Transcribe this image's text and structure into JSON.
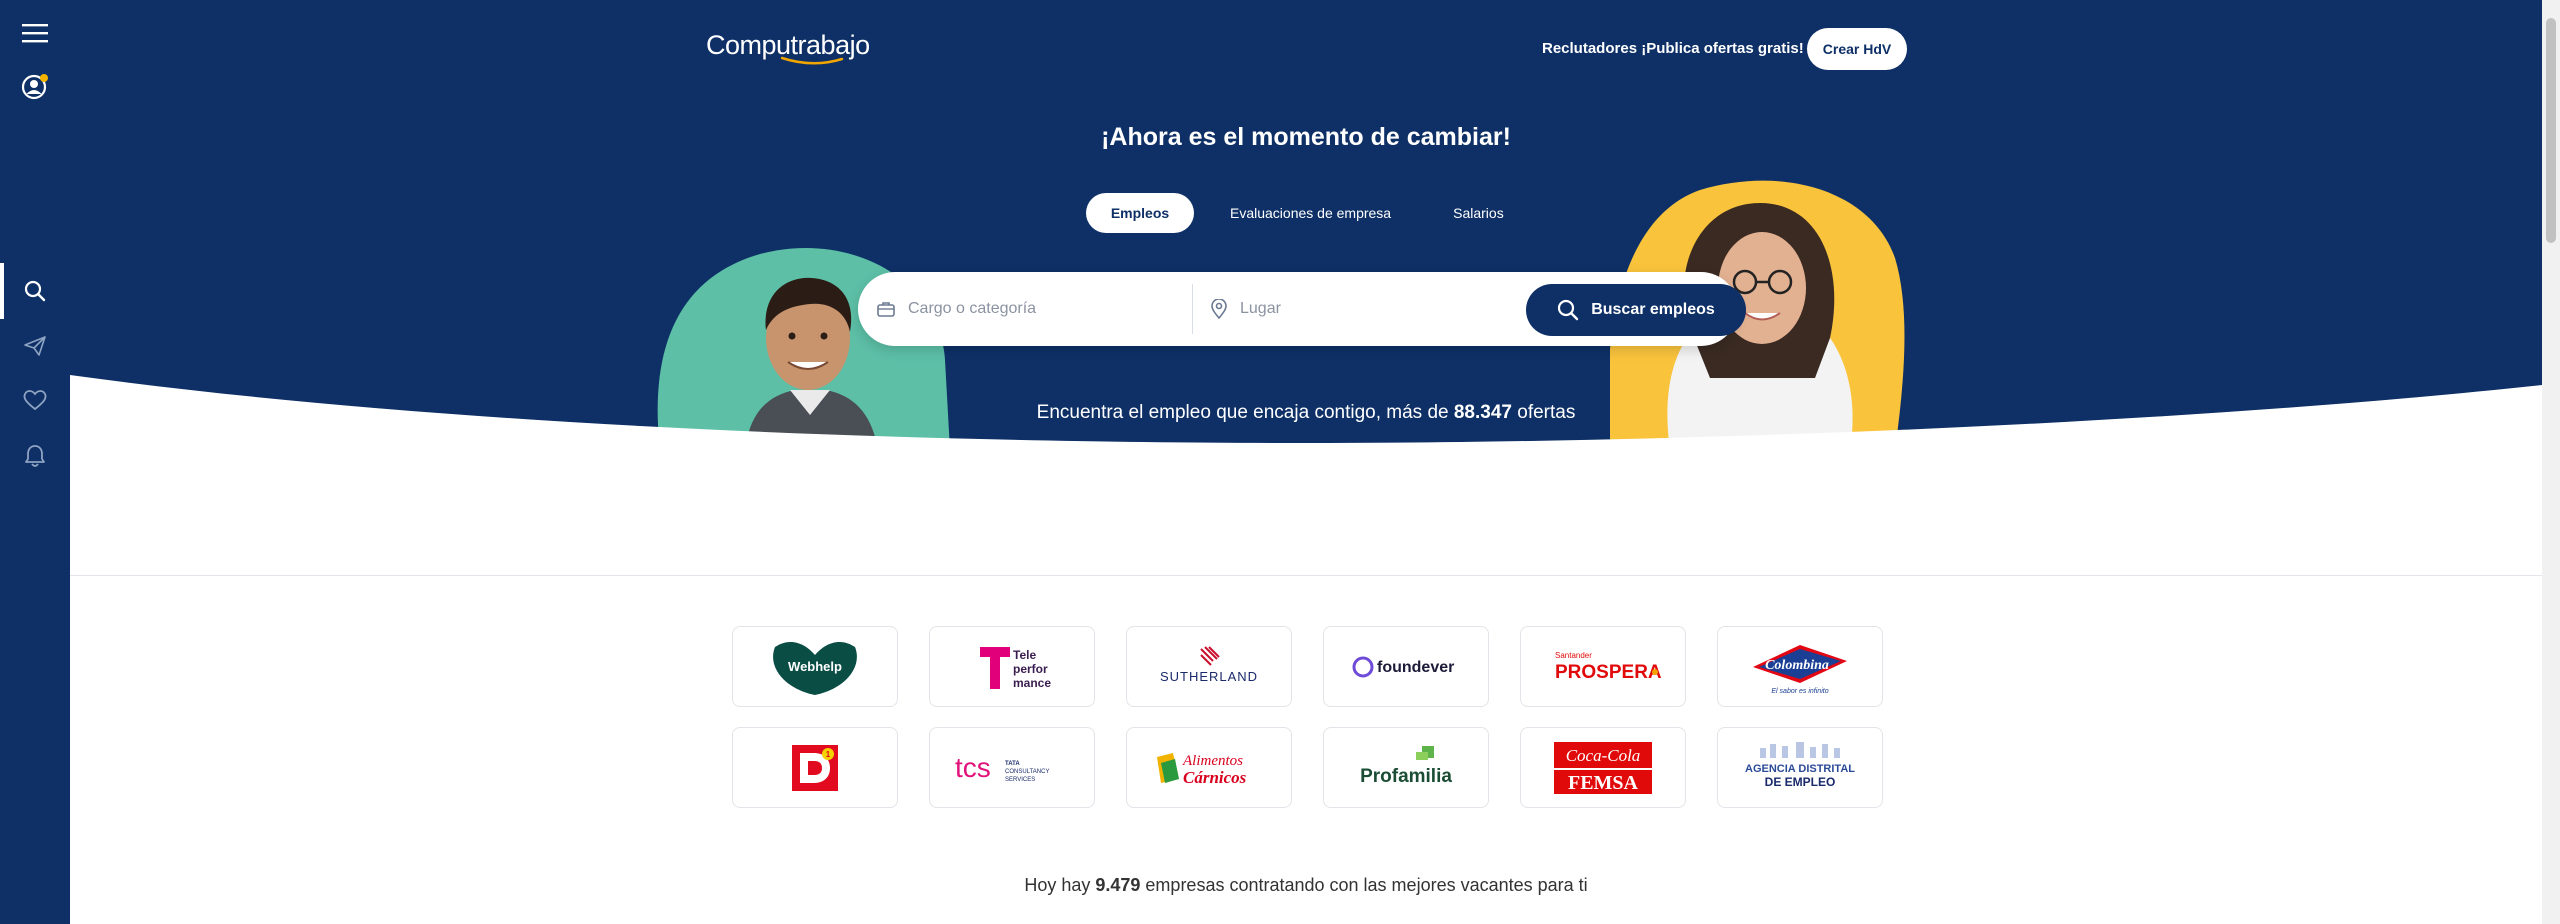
{
  "sidebar": {
    "items": [
      {
        "name": "menu",
        "icon": "menu-icon"
      },
      {
        "name": "profile",
        "icon": "user-icon",
        "badge_color": "#f5b400"
      },
      {
        "name": "search",
        "icon": "search-icon",
        "active": true
      },
      {
        "name": "applications",
        "icon": "send-icon"
      },
      {
        "name": "favorites",
        "icon": "heart-icon"
      },
      {
        "name": "alerts",
        "icon": "bell-icon"
      }
    ]
  },
  "header": {
    "logo_text": "Computrabajo",
    "recruiters_link": "Reclutadores ¡Publica ofertas gratis!",
    "create_cv_label": "Crear HdV"
  },
  "hero": {
    "title": "¡Ahora es el momento de cambiar!",
    "tabs": [
      {
        "label": "Empleos",
        "active": true
      },
      {
        "label": "Evaluaciones de empresa",
        "active": false
      },
      {
        "label": "Salarios",
        "active": false
      }
    ],
    "search": {
      "job_placeholder": "Cargo o categoría",
      "place_placeholder": "Lugar",
      "job_value": "",
      "place_value": "",
      "button_label": "Buscar empleos"
    },
    "tagline_prefix": "Encuentra el empleo que encaja contigo, más de ",
    "tagline_count": "88.347",
    "tagline_suffix": " ofertas"
  },
  "companies_logos": [
    {
      "name": "Webhelp",
      "text": "Webhelp"
    },
    {
      "name": "Teleperformance",
      "text": "Tele perfor mance"
    },
    {
      "name": "Sutherland",
      "text": "SUTHERLAND"
    },
    {
      "name": "Foundever",
      "text": "foundever"
    },
    {
      "name": "Prospera",
      "text": "PROSPERA",
      "subtext": "Santander"
    },
    {
      "name": "Colombina",
      "text": "Colombina",
      "subtext": "El sabor es infinito"
    },
    {
      "name": "D1",
      "text": "D1"
    },
    {
      "name": "TCS",
      "text": "tcs",
      "subtext": "TATA CONSULTANCY SERVICES"
    },
    {
      "name": "Alimentos Carnicos",
      "text": "Alimentos",
      "subtext": "Cárnicos"
    },
    {
      "name": "Profamilia",
      "text": "Profamilia"
    },
    {
      "name": "Coca-Cola FEMSA",
      "text": "Coca-Cola",
      "subtext": "FEMSA"
    },
    {
      "name": "Agencia Distrital de Empleo",
      "text": "AGENCIA DISTRITAL",
      "subtext": "DE EMPLEO"
    }
  ],
  "companies_line": {
    "prefix": "Hoy hay ",
    "count": "9.479",
    "suffix": " empresas contratando con las mejores vacantes para ti"
  },
  "colors": {
    "brand_navy": "#0e3066",
    "accent_yellow": "#f9c33c",
    "accent_teal": "#5cbfa6"
  }
}
